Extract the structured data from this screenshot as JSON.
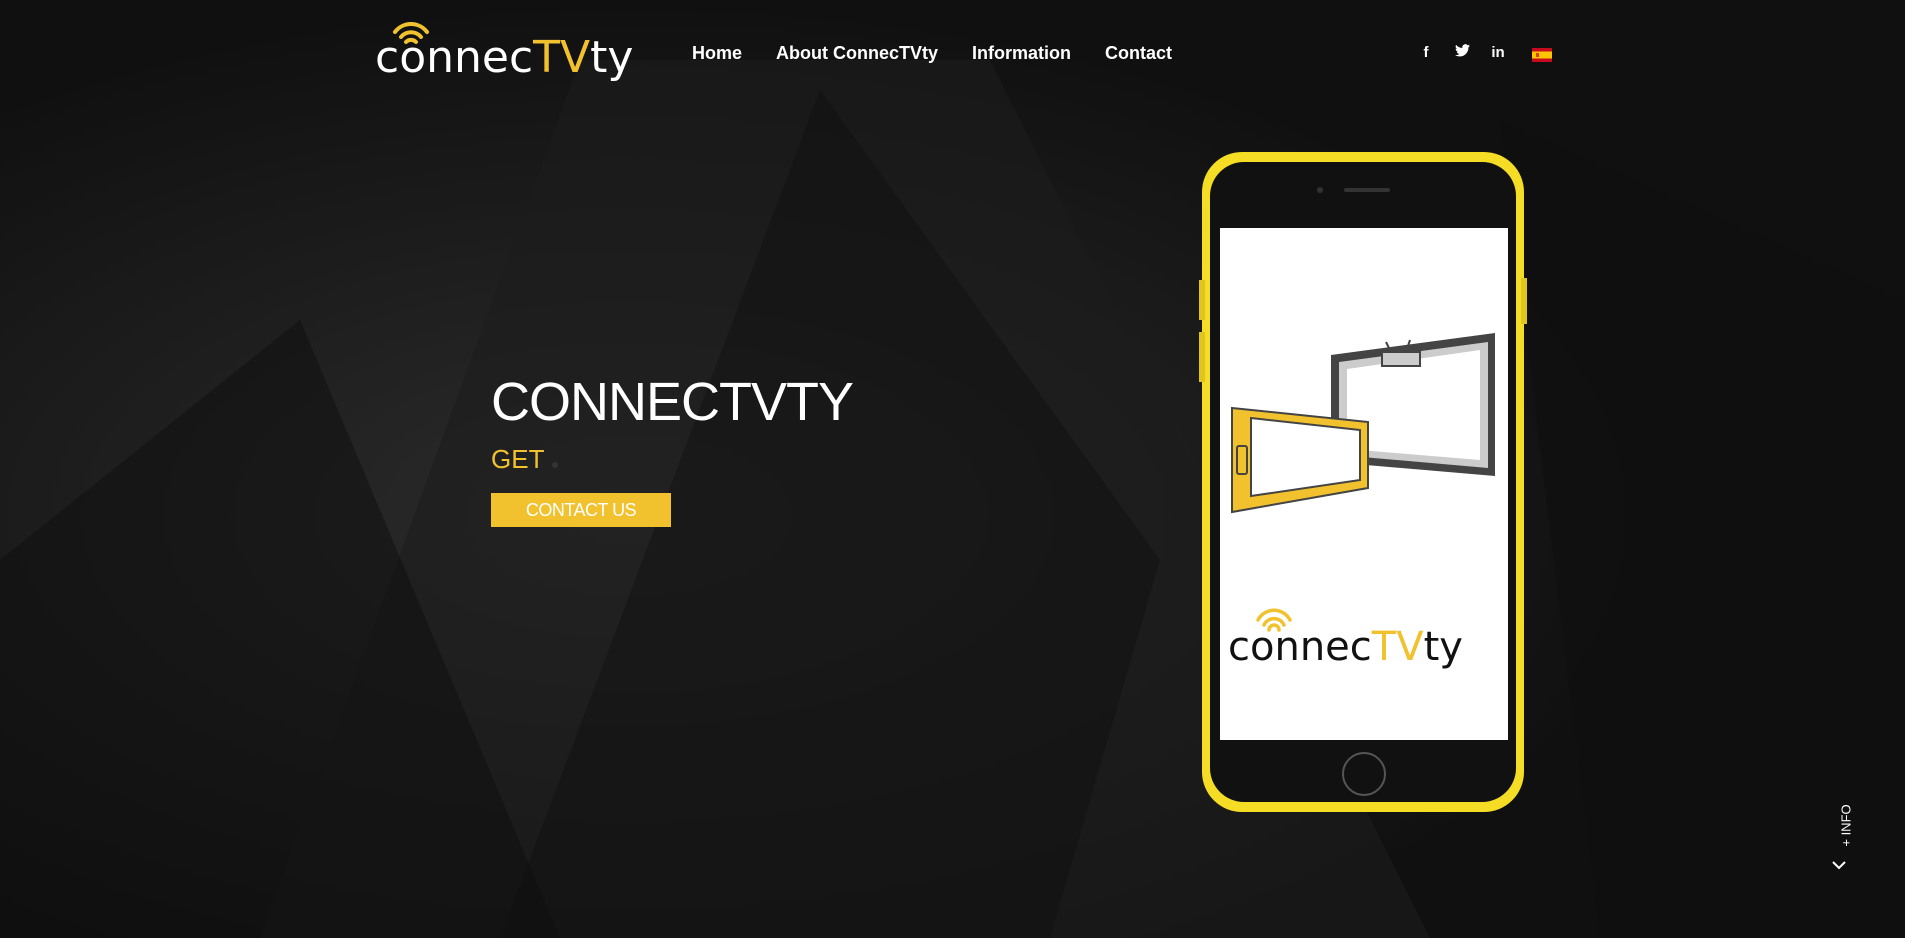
{
  "brand": {
    "word_start": "connec",
    "word_tv": "TV",
    "word_end": "ty"
  },
  "nav": {
    "items": [
      "Home",
      "About ConnecTVty",
      "Information",
      "Contact"
    ]
  },
  "social": {
    "facebook": "f",
    "twitter": "twitter-icon",
    "linkedin": "in",
    "language_flag": "spain-flag-icon"
  },
  "hero": {
    "title": "CONNECTVTY",
    "subtitle": "GET",
    "cta_label": "CONTACT US"
  },
  "phone_screen": {
    "word_start": "connec",
    "word_tv": "TV",
    "word_end": "ty"
  },
  "info": {
    "label": "+ INFO"
  },
  "colors": {
    "accent": "#f2c12e",
    "phone_frame": "#f5dc25",
    "background": "#141414"
  }
}
